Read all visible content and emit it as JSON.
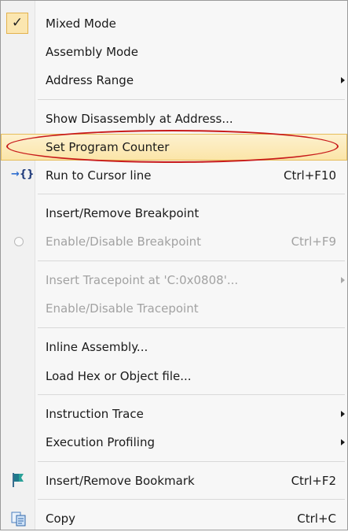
{
  "menu": {
    "items": [
      {
        "label": "Mixed Mode"
      },
      {
        "label": "Assembly Mode"
      },
      {
        "label": "Address Range"
      },
      {
        "label": "Show Disassembly at Address..."
      },
      {
        "label": "Set Program Counter"
      },
      {
        "label": "Run to Cursor line",
        "shortcut": "Ctrl+F10"
      },
      {
        "label": "Insert/Remove Breakpoint"
      },
      {
        "label": "Enable/Disable Breakpoint",
        "shortcut": "Ctrl+F9"
      },
      {
        "label": "Insert Tracepoint at 'C:0x0808'..."
      },
      {
        "label": "Enable/Disable Tracepoint"
      },
      {
        "label": "Inline Assembly..."
      },
      {
        "label": "Load Hex or Object file..."
      },
      {
        "label": "Instruction Trace"
      },
      {
        "label": "Execution Profiling"
      },
      {
        "label": "Insert/Remove Bookmark",
        "shortcut": "Ctrl+F2"
      },
      {
        "label": "Copy",
        "shortcut": "Ctrl+C"
      }
    ],
    "check_glyph": "✓",
    "run_icon_text": "{}",
    "run_icon_arrow": "→"
  },
  "state": {
    "mixed_mode_checked": true,
    "highlighted_item": "Set Program Counter",
    "disabled_items": [
      "Enable/Disable Breakpoint",
      "Insert Tracepoint at 'C:0x0808'...",
      "Enable/Disable Tracepoint"
    ]
  },
  "colors": {
    "highlight": "#fbe5a8",
    "annotation_ellipse": "#c81a1a",
    "disabled_text": "#a2a2a2"
  },
  "icons": [
    "checkmark-icon",
    "run-to-cursor-icon",
    "breakpoint-radio-icon",
    "bookmark-flag-icon",
    "copy-icon",
    "submenu-arrow-icon"
  ]
}
